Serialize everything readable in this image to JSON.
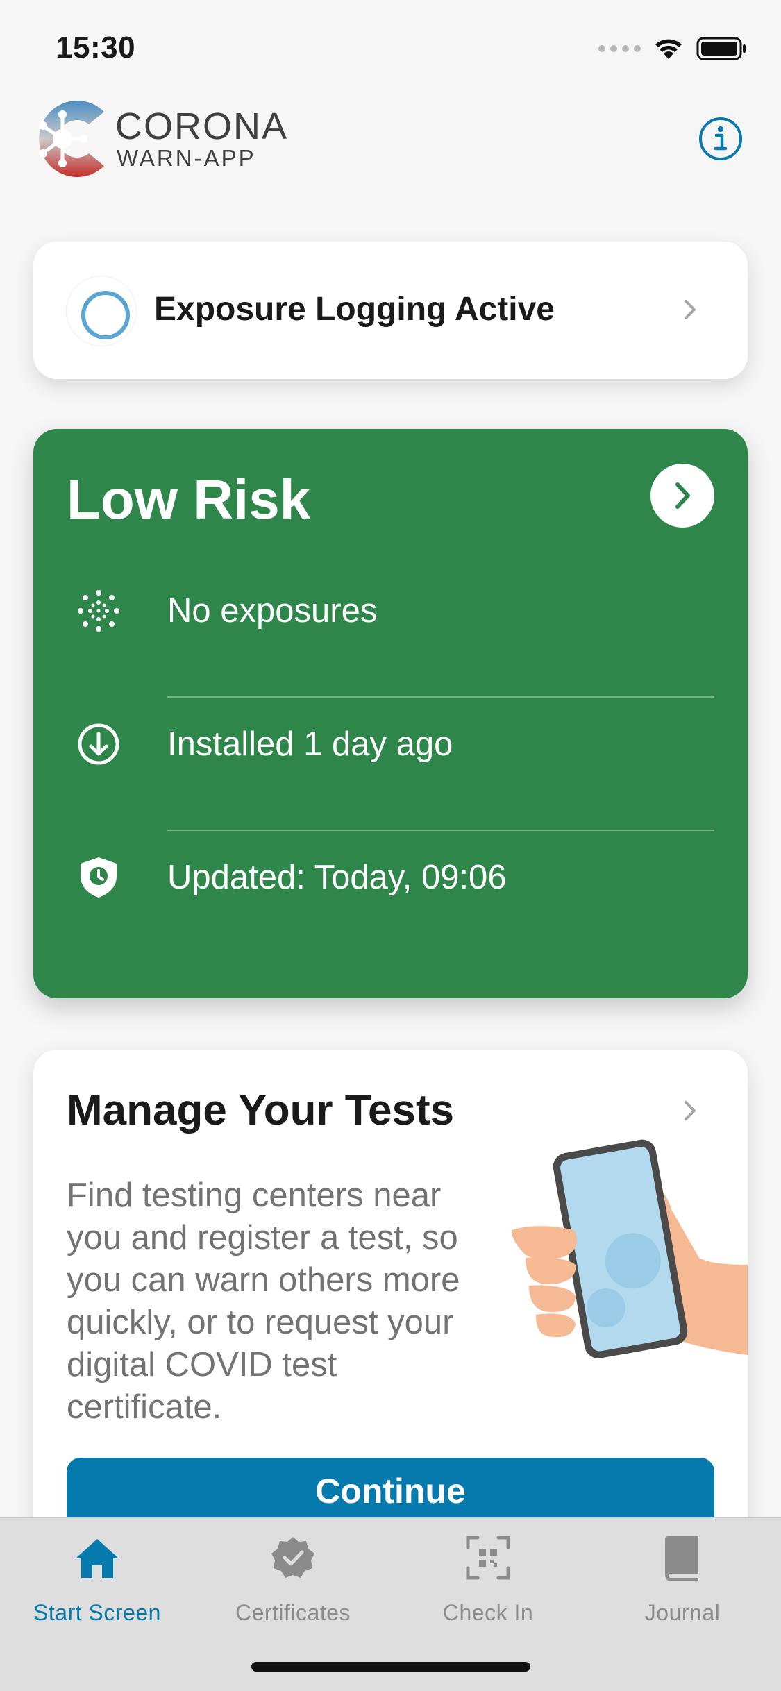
{
  "status_bar": {
    "time": "15:30"
  },
  "header": {
    "logo_line1": "CORONA",
    "logo_line2": "WARN-APP"
  },
  "exposure_card": {
    "label": "Exposure Logging Active"
  },
  "risk_card": {
    "title": "Low Risk",
    "color": "#2f864b",
    "rows": [
      {
        "icon": "virus-icon",
        "text": "No exposures"
      },
      {
        "icon": "download-icon",
        "text": "Installed 1 day ago"
      },
      {
        "icon": "shield-clock-icon",
        "text": "Updated: Today, 09:06"
      }
    ]
  },
  "tests_card": {
    "title": "Manage Your Tests",
    "body": "Find testing centers near you and register a test, so you can warn others more quickly, or to request your digital COVID test certificate.",
    "button": "Continue"
  },
  "tab_bar": {
    "tabs": [
      {
        "label": "Start Screen",
        "icon": "home-icon",
        "active": true
      },
      {
        "label": "Certificates",
        "icon": "certificate-icon",
        "active": false
      },
      {
        "label": "Check In",
        "icon": "qr-scan-icon",
        "active": false
      },
      {
        "label": "Journal",
        "icon": "book-icon",
        "active": false
      }
    ]
  },
  "accent_color": "#0679ad"
}
